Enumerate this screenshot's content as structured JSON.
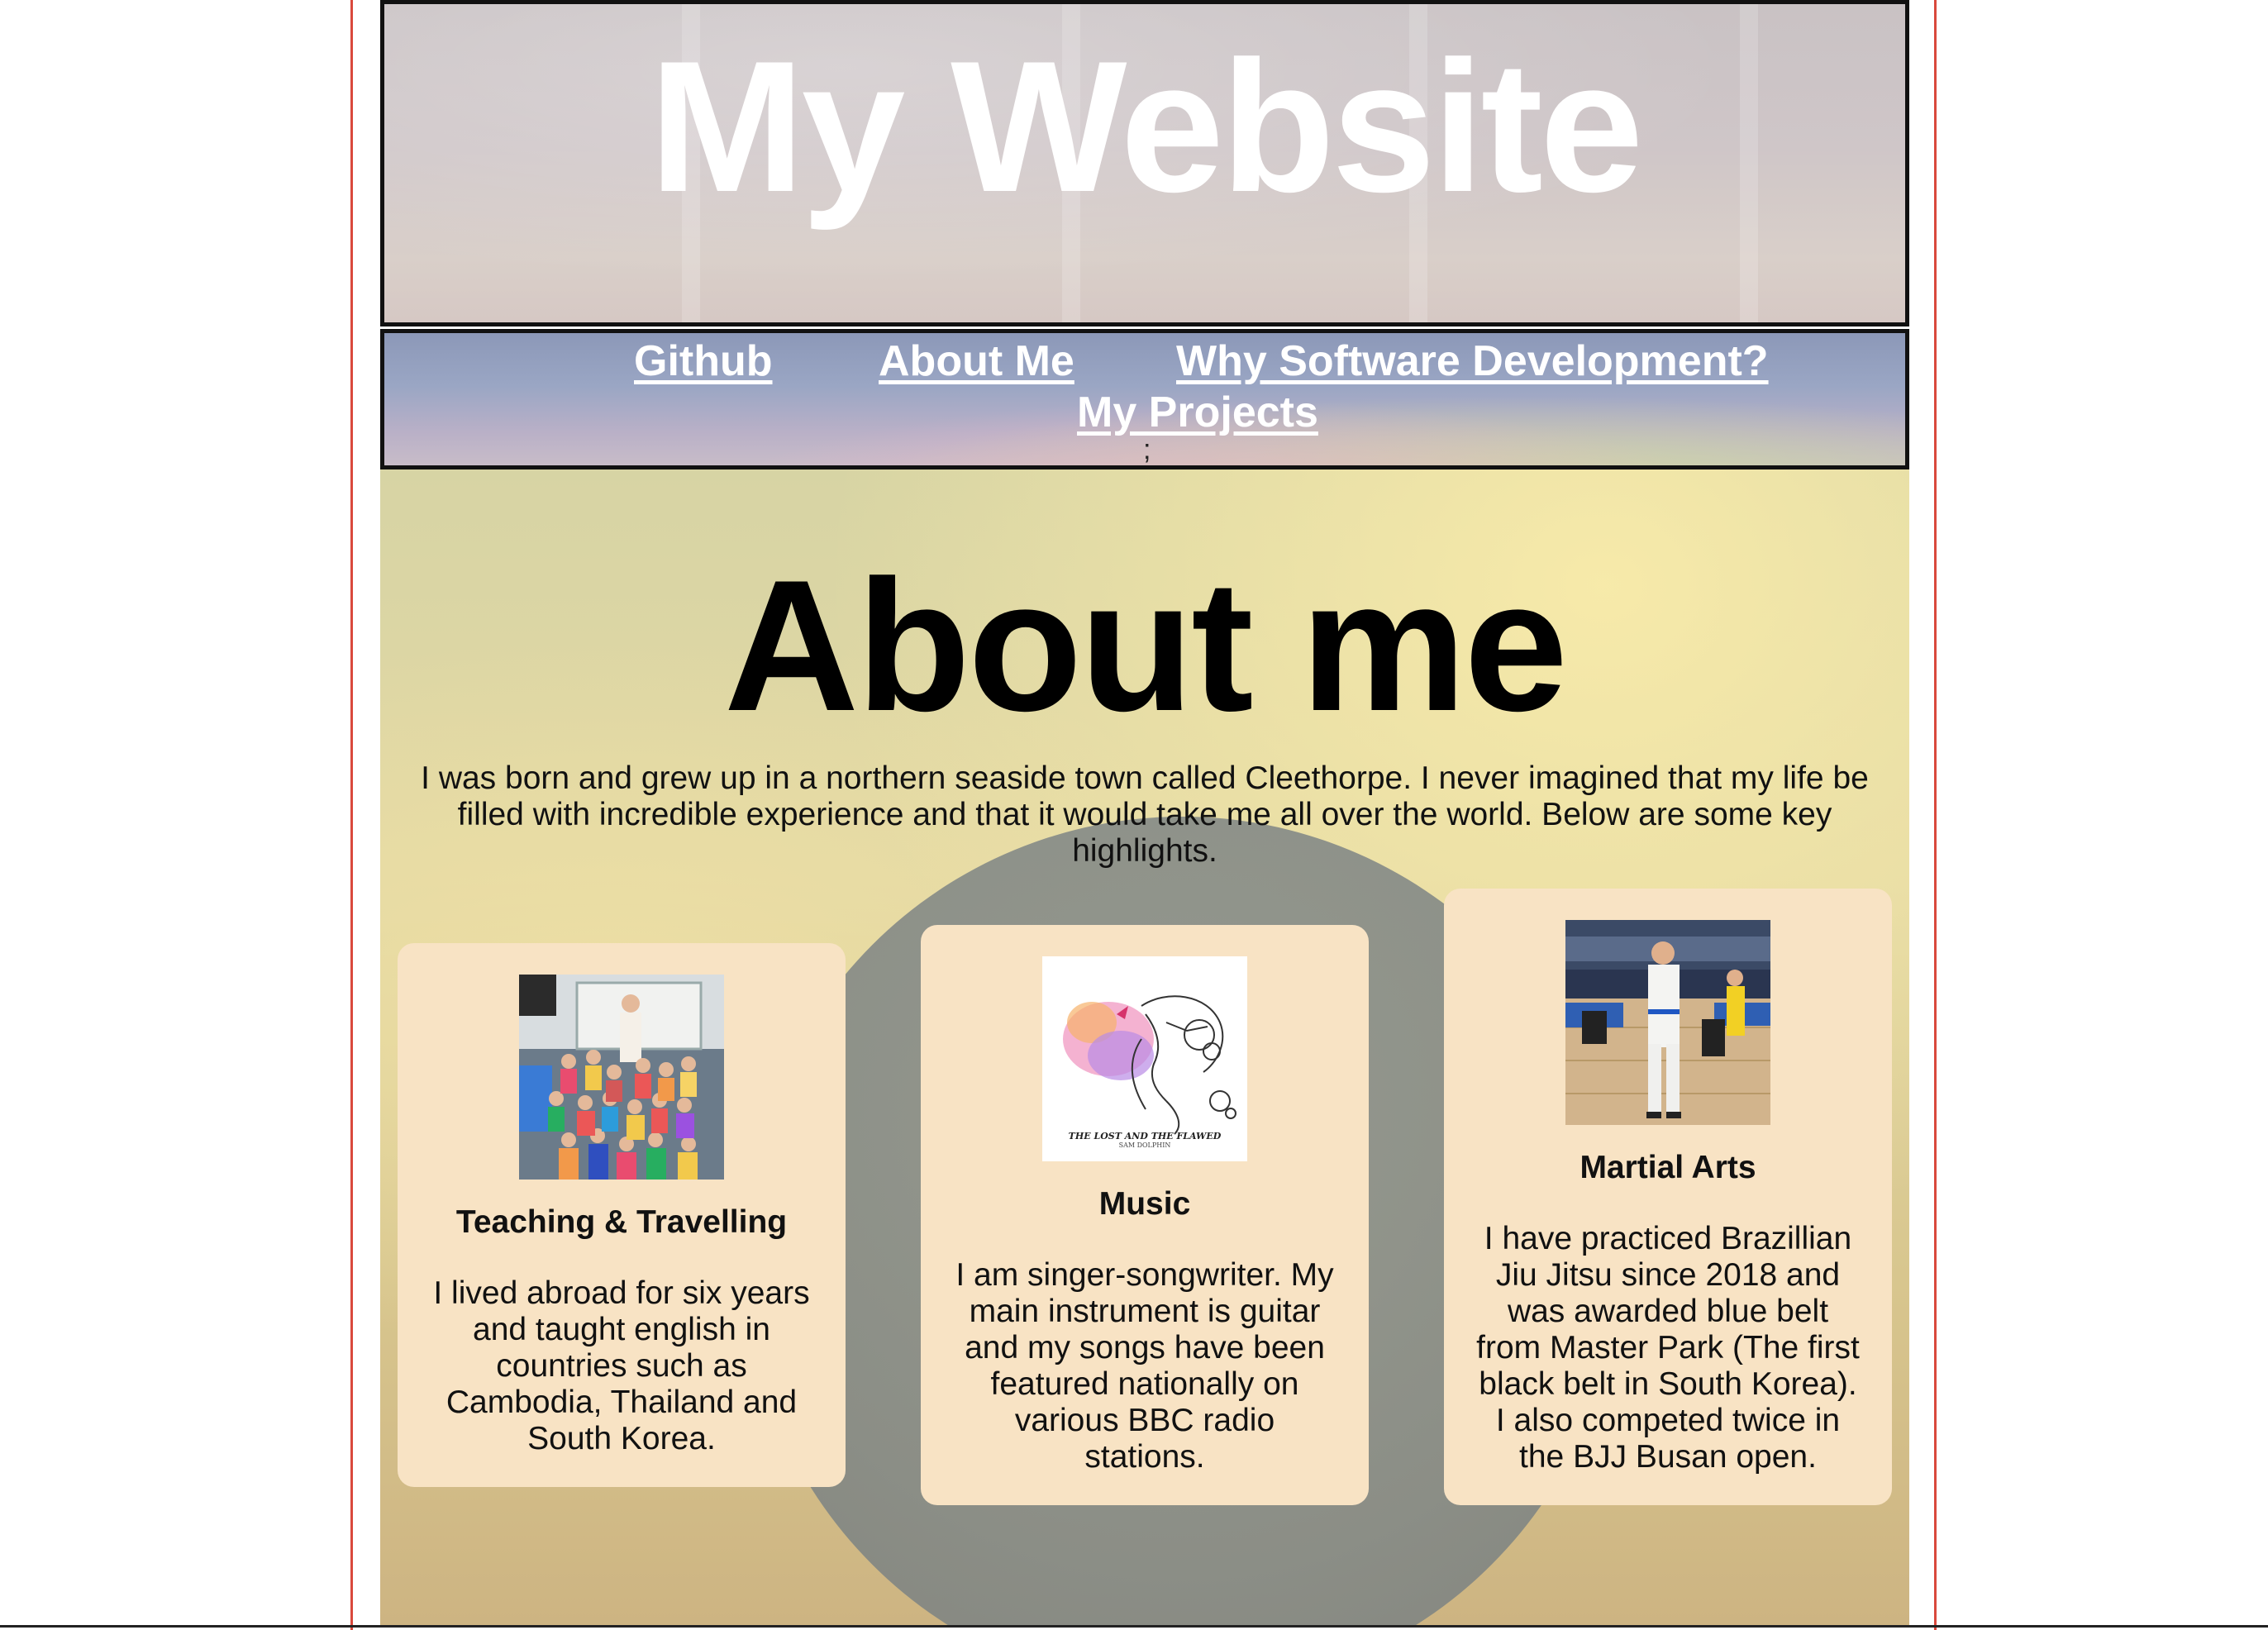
{
  "header": {
    "title": "My Website"
  },
  "nav": {
    "links": [
      "Github",
      "About Me",
      "Why Software Development?",
      "My Projects"
    ],
    "stray_char": ";"
  },
  "main": {
    "title": "About me",
    "intro": "I was born and grew up in a northern seaside town called Cleethorpe. I never imagined that my life be filled with incredible experience and that it would take me all over the world. Below are some key highlights.",
    "cards": [
      {
        "heading": "Teaching & Travelling",
        "text": "I lived abroad for six years and taught english in countries such as Cambodia, Thailand and South Korea.",
        "image": "classroom-photo"
      },
      {
        "heading": "Music",
        "text": "I am singer-songwriter. My main instrument is guitar and my songs have been featured nationally on various BBC radio stations.",
        "image": "album-cover",
        "album_caption": "THE LOST AND THE FLAWED",
        "album_artist": "SAM DOLPHIN"
      },
      {
        "heading": "Martial Arts",
        "text": "I have practiced Brazillian Jiu Jitsu since 2018 and was awarded blue belt from Master Park (The first black belt in South Korea). I also competed twice in the BJJ Busan open.",
        "image": "bjj-tournament-photo"
      }
    ]
  },
  "colors": {
    "border_red": "#d9493c",
    "card_bg": "#f8e3c4",
    "nav_link": "#ffffff"
  }
}
